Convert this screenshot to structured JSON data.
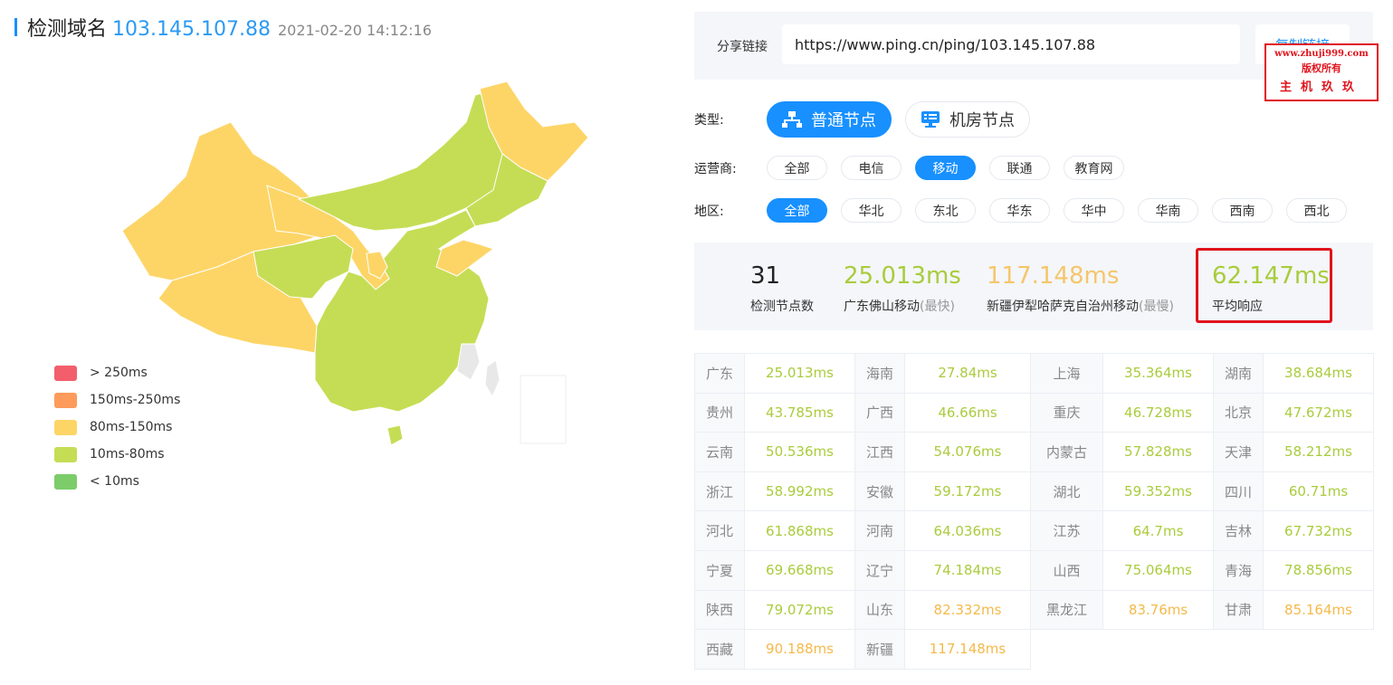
{
  "header": {
    "title": "检测域名",
    "ip": "103.145.107.88",
    "time": "2021-02-20 14:12:16"
  },
  "share": {
    "label": "分享链接",
    "url": "https://www.ping.cn/ping/103.145.107.88",
    "copy_label": "复制链接"
  },
  "watermark": {
    "line1": "www.zhuji999.com",
    "line2": "版权所有",
    "line3": "主机玖玖"
  },
  "filters": {
    "type_label": "类型:",
    "types": [
      {
        "label": "普通节点",
        "active": true,
        "icon": "network-icon"
      },
      {
        "label": "机房节点",
        "active": false,
        "icon": "server-icon"
      }
    ],
    "isp_label": "运营商:",
    "isps": [
      {
        "label": "全部",
        "active": false
      },
      {
        "label": "电信",
        "active": false
      },
      {
        "label": "移动",
        "active": true
      },
      {
        "label": "联通",
        "active": false
      },
      {
        "label": "教育网",
        "active": false
      }
    ],
    "region_label": "地区:",
    "regions": [
      {
        "label": "全部",
        "active": true
      },
      {
        "label": "华北",
        "active": false
      },
      {
        "label": "东北",
        "active": false
      },
      {
        "label": "华东",
        "active": false
      },
      {
        "label": "华中",
        "active": false
      },
      {
        "label": "华南",
        "active": false
      },
      {
        "label": "西南",
        "active": false
      },
      {
        "label": "西北",
        "active": false
      }
    ]
  },
  "stats": {
    "count": {
      "value": "31",
      "label": "检测节点数"
    },
    "fastest": {
      "value": "25.013ms",
      "label": "广东佛山移动",
      "sub": "(最快)"
    },
    "slowest": {
      "value": "117.148ms",
      "label": "新疆伊犁哈萨克自治州移动",
      "sub": "(最慢)"
    },
    "average": {
      "value": "62.147ms",
      "label": "平均响应"
    }
  },
  "legend": [
    {
      "label": "> 250ms",
      "color": "#f25e6b"
    },
    {
      "label": "150ms-250ms",
      "color": "#fd9b5c"
    },
    {
      "label": "80ms-150ms",
      "color": "#fdd567"
    },
    {
      "label": "10ms-80ms",
      "color": "#c5dd55"
    },
    {
      "label": "< 10ms",
      "color": "#7ccc6a"
    }
  ],
  "colors": {
    "accent": "#1890ff",
    "good": "#a9cc3c",
    "medium": "#f5b94a",
    "map_gray": "#e8e8e8"
  },
  "results": [
    {
      "province": "广东",
      "value": "25.013ms",
      "level": "good"
    },
    {
      "province": "海南",
      "value": "27.84ms",
      "level": "good"
    },
    {
      "province": "上海",
      "value": "35.364ms",
      "level": "good"
    },
    {
      "province": "湖南",
      "value": "38.684ms",
      "level": "good"
    },
    {
      "province": "贵州",
      "value": "43.785ms",
      "level": "good"
    },
    {
      "province": "广西",
      "value": "46.66ms",
      "level": "good"
    },
    {
      "province": "重庆",
      "value": "46.728ms",
      "level": "good"
    },
    {
      "province": "北京",
      "value": "47.672ms",
      "level": "good"
    },
    {
      "province": "云南",
      "value": "50.536ms",
      "level": "good"
    },
    {
      "province": "江西",
      "value": "54.076ms",
      "level": "good"
    },
    {
      "province": "内蒙古",
      "value": "57.828ms",
      "level": "good"
    },
    {
      "province": "天津",
      "value": "58.212ms",
      "level": "good"
    },
    {
      "province": "浙江",
      "value": "58.992ms",
      "level": "good"
    },
    {
      "province": "安徽",
      "value": "59.172ms",
      "level": "good"
    },
    {
      "province": "湖北",
      "value": "59.352ms",
      "level": "good"
    },
    {
      "province": "四川",
      "value": "60.71ms",
      "level": "good"
    },
    {
      "province": "河北",
      "value": "61.868ms",
      "level": "good"
    },
    {
      "province": "河南",
      "value": "64.036ms",
      "level": "good"
    },
    {
      "province": "江苏",
      "value": "64.7ms",
      "level": "good"
    },
    {
      "province": "吉林",
      "value": "67.732ms",
      "level": "good"
    },
    {
      "province": "宁夏",
      "value": "69.668ms",
      "level": "good"
    },
    {
      "province": "辽宁",
      "value": "74.184ms",
      "level": "good"
    },
    {
      "province": "山西",
      "value": "75.064ms",
      "level": "good"
    },
    {
      "province": "青海",
      "value": "78.856ms",
      "level": "good"
    },
    {
      "province": "陕西",
      "value": "79.072ms",
      "level": "good"
    },
    {
      "province": "山东",
      "value": "82.332ms",
      "level": "medium"
    },
    {
      "province": "黑龙江",
      "value": "83.76ms",
      "level": "medium"
    },
    {
      "province": "甘肃",
      "value": "85.164ms",
      "level": "medium"
    },
    {
      "province": "西藏",
      "value": "90.188ms",
      "level": "medium"
    },
    {
      "province": "新疆",
      "value": "117.148ms",
      "level": "medium"
    }
  ]
}
